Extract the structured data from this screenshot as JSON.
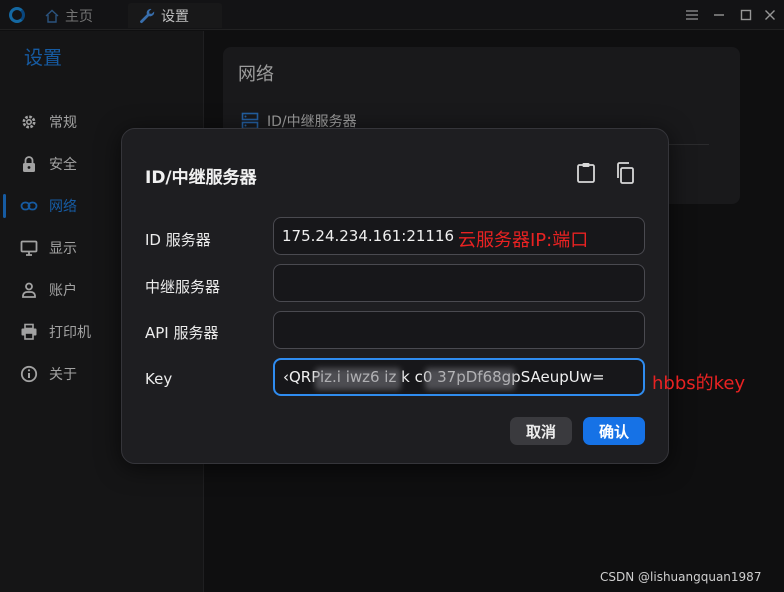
{
  "titlebar": {
    "tabs": [
      {
        "label": "主页"
      },
      {
        "label": "设置"
      }
    ]
  },
  "sidebar": {
    "title": "设置",
    "items": [
      {
        "label": "常规",
        "icon": "gear-icon"
      },
      {
        "label": "安全",
        "icon": "lock-icon"
      },
      {
        "label": "网络",
        "icon": "link-icon",
        "active": true
      },
      {
        "label": "显示",
        "icon": "monitor-icon"
      },
      {
        "label": "账户",
        "icon": "user-icon"
      },
      {
        "label": "打印机",
        "icon": "printer-icon"
      },
      {
        "label": "关于",
        "icon": "info-icon"
      }
    ]
  },
  "main": {
    "title": "网络",
    "section": "ID/中继服务器"
  },
  "dialog": {
    "title": "ID/中继服务器",
    "fields": [
      {
        "label": "ID 服务器",
        "value": "175.24.234.161:21116"
      },
      {
        "label": "中继服务器",
        "value": ""
      },
      {
        "label": "API 服务器",
        "value": ""
      },
      {
        "label": "Key",
        "value": "‹QRPiz.i iwz6 iz    k    c0 37pDf68gpSAeupUw="
      }
    ],
    "annotations": {
      "id_server": "云服务器IP:端口",
      "key": "hbbs的key"
    },
    "cancel_label": "取消",
    "ok_label": "确认"
  },
  "watermark": "CSDN @lishuangquan1987",
  "colors": {
    "accent": "#1e7ad9",
    "button_primary": "#1672e6",
    "annotation": "#e82222"
  }
}
